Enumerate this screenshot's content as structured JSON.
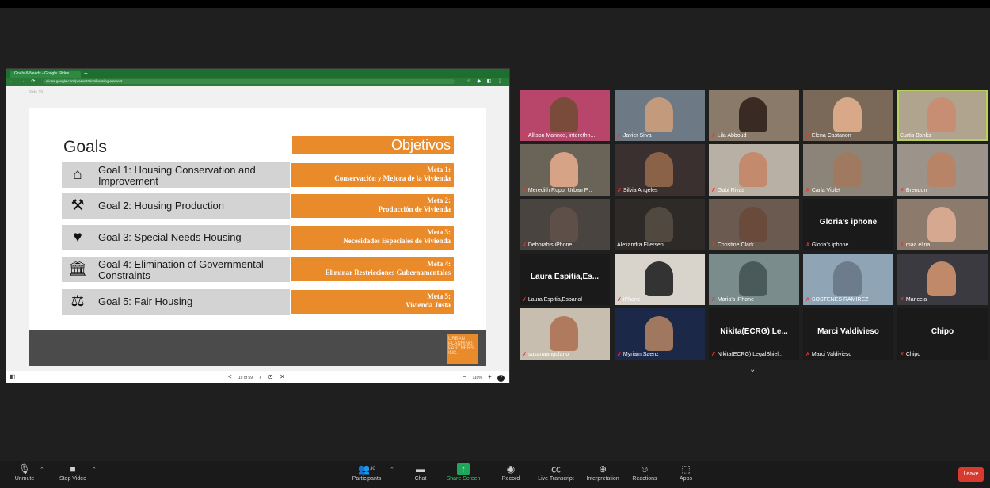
{
  "browser": {
    "tab_title": "Goals & Needs - Google Slides",
    "new_tab": "+",
    "url": "slides.google.com/presentation/housing-element",
    "doc_label": "Slide 19"
  },
  "slide": {
    "title": "Goals",
    "objetivos": "Objetivos",
    "goals": [
      {
        "icon": "⌂",
        "icon_name": "house-hands-icon",
        "text": "Goal 1: Housing Conservation and Improvement",
        "meta": "Meta 1:",
        "meta_sub": "Conservación y Mejora de la Vivienda"
      },
      {
        "icon": "⚒",
        "icon_name": "hammer-icon",
        "text": "Goal 2: Housing Production",
        "meta": "Meta 2:",
        "meta_sub": "Producción de Vivienda"
      },
      {
        "icon": "♥",
        "icon_name": "heart-hand-icon",
        "text": "Goal 3: Special Needs Housing",
        "meta": "Meta 3:",
        "meta_sub": "Necesidades Especiales de Vivienda"
      },
      {
        "icon": "🏛",
        "icon_name": "government-building-icon",
        "text": "Goal 4: Elimination of Governmental Constraints",
        "meta": "Meta 4:",
        "meta_sub": "Eliminar Restricciones Gubernamentales"
      },
      {
        "icon": "⚖",
        "icon_name": "fair-housing-icon",
        "text": "Goal 5: Fair Housing",
        "meta": "Meta 5:",
        "meta_sub": "Vivienda Justa"
      }
    ],
    "footer_logo": "URBAN PLANNING PARTNERS INC."
  },
  "doc_controls": {
    "sidebar": "◧",
    "prev": "<",
    "page": "19 of 59",
    "next": "›",
    "present": "⊙",
    "close": "✕",
    "zoom_out": "−",
    "zoom": "110%",
    "zoom_in": "+",
    "help": "?"
  },
  "participants": [
    {
      "name": "Allison Mannos, interethn...",
      "bg": "#b8466a",
      "skin": "#7a4a3a",
      "kind": "video",
      "muted": true
    },
    {
      "name": "Javier Silva",
      "bg": "#6d7a86",
      "skin": "#c49a7c",
      "kind": "video",
      "muted": true
    },
    {
      "name": "Lila Abboud",
      "bg": "#8a7a6a",
      "skin": "#3a2a24",
      "kind": "video",
      "muted": true
    },
    {
      "name": "Elena Castanon",
      "bg": "#7a6858",
      "skin": "#d8a888",
      "kind": "video",
      "muted": true
    },
    {
      "name": "Curtis Banks",
      "bg": "#b0a48e",
      "skin": "#c88e74",
      "kind": "video",
      "muted": false,
      "active": true
    },
    {
      "name": "Meredith Rupp, Urban P...",
      "bg": "#6a6458",
      "skin": "#d6a386",
      "kind": "video",
      "muted": true
    },
    {
      "name": "Silvia Angeles",
      "bg": "#3a3030",
      "skin": "#8a6248",
      "kind": "video",
      "muted": true
    },
    {
      "name": "Gabi Rivas",
      "bg": "#b8b0a4",
      "skin": "#c48a6e",
      "kind": "video",
      "muted": true
    },
    {
      "name": "Carla Violet",
      "bg": "#8c8478",
      "skin": "#a07a60",
      "kind": "video",
      "muted": true
    },
    {
      "name": "Brendon",
      "bg": "#9c938a",
      "skin": "#b88468",
      "kind": "video",
      "muted": true
    },
    {
      "name": "Deborah's iPhone",
      "bg": "#4a4440",
      "skin": "#5e5048",
      "kind": "video",
      "muted": true
    },
    {
      "name": "Alexandra Ellersen",
      "bg": "#2e2a28",
      "skin": "#514840",
      "kind": "video",
      "muted": false
    },
    {
      "name": "Christine Clark",
      "bg": "#6a5a50",
      "skin": "#6a4a3a",
      "kind": "video",
      "muted": true
    },
    {
      "name": "Gloria's iphone",
      "bg": "#1a1a1a",
      "kind": "text",
      "big": "Gloria's iphone",
      "muted": true
    },
    {
      "name": "maa elina",
      "bg": "#8c7a6c",
      "skin": "#d6a890",
      "kind": "video",
      "muted": true
    },
    {
      "name": "Laura Espitia,Espanol",
      "bg": "#1a1a1a",
      "kind": "text",
      "big": "Laura Espitia,Es...",
      "muted": true
    },
    {
      "name": "iPhone",
      "bg": "#d8d4cc",
      "skin": "#333333",
      "kind": "video",
      "muted": true
    },
    {
      "name": "Maria's iPhone",
      "bg": "#7a8c8c",
      "skin": "#4a5a5a",
      "kind": "video",
      "muted": true
    },
    {
      "name": "SOSTENES RAMIREZ",
      "bg": "#8fa4b4",
      "skin": "#6c7c8a",
      "kind": "video",
      "muted": true
    },
    {
      "name": "Maricela",
      "bg": "#3a3a40",
      "skin": "#c08a6a",
      "kind": "video",
      "muted": true
    },
    {
      "name": "susanaangulano",
      "bg": "#c8beb0",
      "skin": "#b07a5e",
      "kind": "video",
      "muted": true
    },
    {
      "name": "Myriam Saenz",
      "bg": "#1c2848",
      "skin": "#a07860",
      "kind": "video",
      "muted": true
    },
    {
      "name": "Nikita(ECRG) LegalShiel...",
      "bg": "#1a1a1a",
      "kind": "text",
      "big": "Nikita(ECRG)  Le...",
      "muted": true
    },
    {
      "name": "Marci Valdivieso",
      "bg": "#1a1a1a",
      "kind": "text",
      "big": "Marci Valdivieso",
      "muted": true
    },
    {
      "name": "Chipo",
      "bg": "#1a1a1a",
      "kind": "text",
      "big": "Chipo",
      "muted": true
    }
  ],
  "gallery_chevron": "⌄",
  "toolbar": {
    "unmute": "Unmute",
    "stop_video": "Stop Video",
    "participants": "Participants",
    "participants_count": "30",
    "chat": "Chat",
    "share": "Share Screen",
    "record": "Record",
    "live_transcript": "Live Transcript",
    "interpretation": "Interpretation",
    "reactions": "Reactions",
    "apps": "Apps",
    "leave": "Leave"
  }
}
